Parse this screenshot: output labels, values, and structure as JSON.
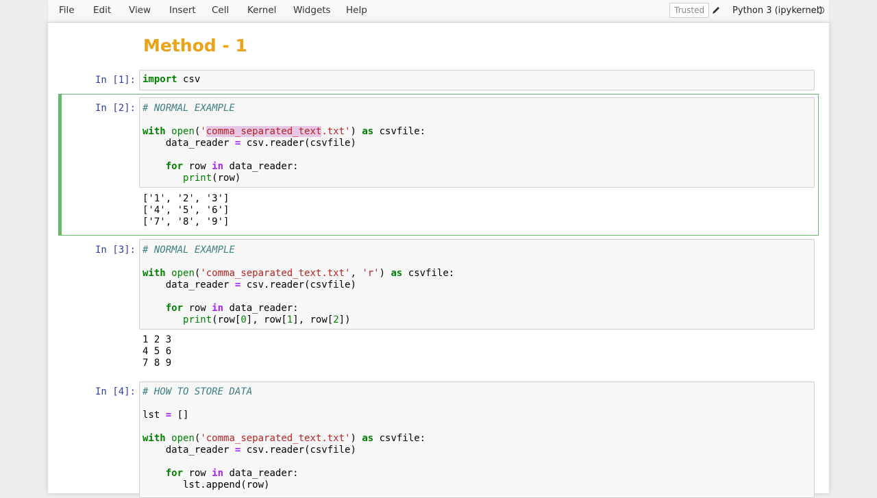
{
  "menu": {
    "items": [
      "File",
      "Edit",
      "View",
      "Insert",
      "Cell",
      "Kernel",
      "Widgets",
      "Help"
    ],
    "trusted": "Trusted",
    "kernel": "Python 3 (ipykernel)"
  },
  "notebook": {
    "heading": "Method - 1",
    "cells": [
      {
        "prompt": "In [1]:"
      },
      {
        "prompt": "In [2]:"
      },
      {
        "prompt": "In [3]:"
      },
      {
        "prompt": "In [4]:"
      }
    ],
    "code": {
      "c1_import": "import",
      "c1_module": " csv",
      "c2_comment": "# NORMAL EXAMPLE",
      "c3_comment": "# NORMAL EXAMPLE",
      "c4_comment": "# HOW TO STORE DATA"
    },
    "outputs": {
      "c2": "['1', '2', '3']\n['4', '5', '6']\n['7', '8', '9']",
      "c3": "1 2 3\n4 5 6\n7 8 9"
    }
  },
  "colors": {
    "heading": "#e8a317",
    "selected_border": "#66bb6a",
    "prompt": "#303f9f"
  }
}
